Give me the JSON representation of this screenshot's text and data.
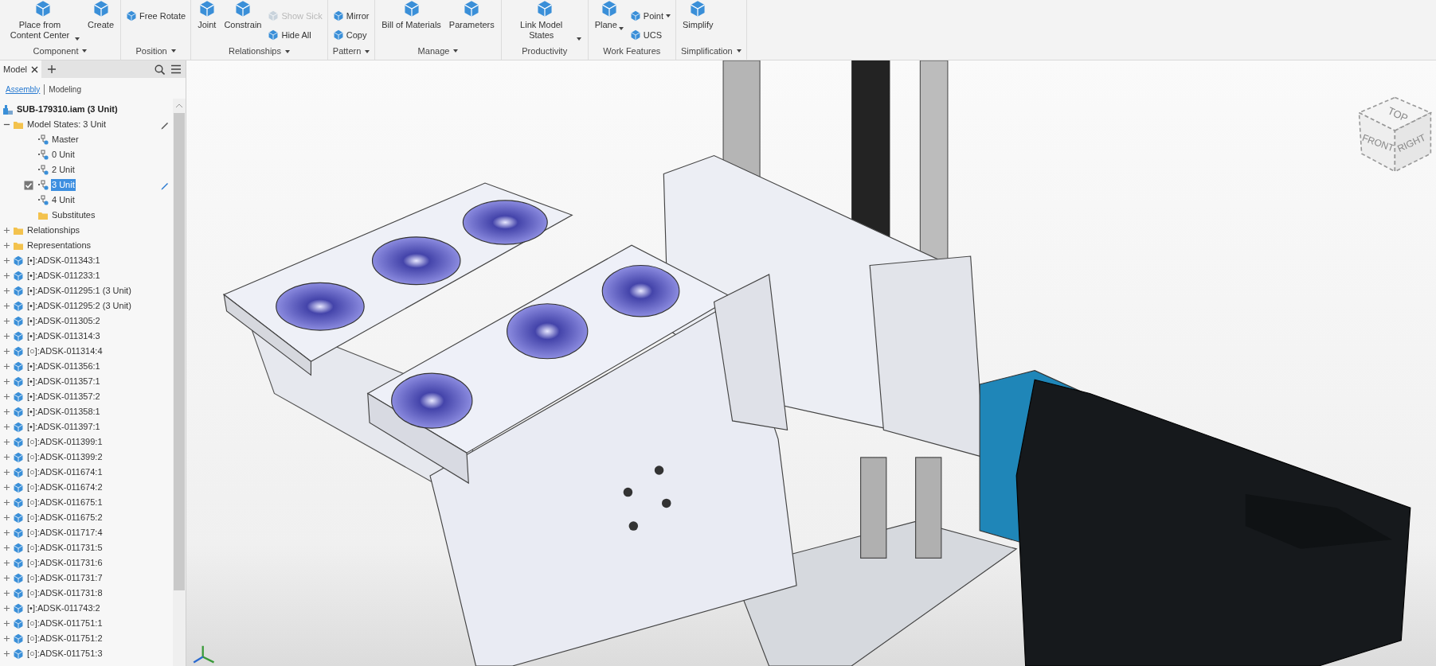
{
  "ribbon": {
    "groups": [
      {
        "label": "Component",
        "menu": true,
        "items": [
          {
            "kind": "large",
            "label": "Place from Content Center",
            "dropdown": true
          },
          {
            "kind": "large",
            "label": "Create",
            "dropdown": false
          }
        ]
      },
      {
        "label": "Position",
        "menu": true,
        "items": [
          {
            "kind": "stack",
            "buttons": [
              {
                "label": "Free Rotate",
                "disabled": false,
                "dropdown": false
              }
            ]
          }
        ]
      },
      {
        "label": "Relationships",
        "menu": true,
        "items": [
          {
            "kind": "large",
            "label": "Joint",
            "dropdown": false
          },
          {
            "kind": "large",
            "label": "Constrain",
            "dropdown": false
          },
          {
            "kind": "stack",
            "buttons": [
              {
                "label": "Show Sick",
                "disabled": true,
                "dropdown": false
              },
              {
                "label": "Hide All",
                "disabled": false,
                "dropdown": false
              }
            ]
          }
        ]
      },
      {
        "label": "Pattern",
        "menu": true,
        "items": [
          {
            "kind": "stack",
            "buttons": [
              {
                "label": "Mirror",
                "disabled": false,
                "dropdown": false
              },
              {
                "label": "Copy",
                "disabled": false,
                "dropdown": false
              }
            ]
          }
        ]
      },
      {
        "label": "Manage",
        "menu": true,
        "items": [
          {
            "kind": "large",
            "label": "Bill of Materials",
            "dropdown": false
          },
          {
            "kind": "large",
            "label": "Parameters",
            "dropdown": false
          }
        ]
      },
      {
        "label": "Productivity",
        "menu": false,
        "items": [
          {
            "kind": "large",
            "label": "Link Model States",
            "dropdown": true
          }
        ]
      },
      {
        "label": "Work Features",
        "menu": false,
        "items": [
          {
            "kind": "large",
            "label": "Plane",
            "dropdown": true
          },
          {
            "kind": "stack",
            "buttons": [
              {
                "label": "Point",
                "disabled": false,
                "dropdown": true
              },
              {
                "label": "UCS",
                "disabled": false,
                "dropdown": false
              }
            ]
          }
        ]
      },
      {
        "label": "Simplification",
        "menu": true,
        "items": [
          {
            "kind": "large",
            "label": "Simplify",
            "dropdown": false
          }
        ]
      }
    ]
  },
  "browser": {
    "tabs": [
      {
        "label": "Model",
        "selected": true
      }
    ],
    "modes": [
      {
        "label": "Assembly",
        "selected": true
      },
      {
        "label": "Modeling",
        "selected": false
      }
    ],
    "tree": {
      "label": "SUB-179310.iam (3 Unit)",
      "kind": "assembly",
      "children": [
        {
          "label": "Model States: 3 Unit",
          "kind": "folder",
          "expanded": true,
          "pencil": true,
          "children": [
            {
              "label": "Master",
              "kind": "state",
              "checked": false,
              "selected": false
            },
            {
              "label": "0 Unit",
              "kind": "state",
              "checked": false,
              "selected": false
            },
            {
              "label": "2 Unit",
              "kind": "state",
              "checked": false,
              "selected": false
            },
            {
              "label": "3 Unit",
              "kind": "state",
              "checked": true,
              "selected": true
            },
            {
              "label": "4 Unit",
              "kind": "state",
              "checked": false,
              "selected": false
            },
            {
              "label": "Substitutes",
              "kind": "folder",
              "expanded": false,
              "pencil": false
            }
          ]
        },
        {
          "label": "Relationships",
          "kind": "folder",
          "expanded": false,
          "pencil": false
        },
        {
          "label": "Representations",
          "kind": "folder",
          "expanded": false,
          "pencil": false
        },
        {
          "label": "[•]:ADSK-011343:1",
          "kind": "part",
          "expanded": false
        },
        {
          "label": "[•]:ADSK-011233:1",
          "kind": "part",
          "expanded": false
        },
        {
          "label": "[•]:ADSK-011295:1 (3 Unit)",
          "kind": "part",
          "expanded": false
        },
        {
          "label": "[•]:ADSK-011295:2 (3 Unit)",
          "kind": "part",
          "expanded": false
        },
        {
          "label": "[•]:ADSK-011305:2",
          "kind": "part",
          "expanded": false
        },
        {
          "label": "[•]:ADSK-011314:3",
          "kind": "part",
          "expanded": false
        },
        {
          "label": "[○]:ADSK-011314:4",
          "kind": "part",
          "expanded": false
        },
        {
          "label": "[•]:ADSK-011356:1",
          "kind": "part",
          "expanded": false
        },
        {
          "label": "[•]:ADSK-011357:1",
          "kind": "part",
          "expanded": false
        },
        {
          "label": "[•]:ADSK-011357:2",
          "kind": "part",
          "expanded": false
        },
        {
          "label": "[•]:ADSK-011358:1",
          "kind": "part",
          "expanded": false
        },
        {
          "label": "[•]:ADSK-011397:1",
          "kind": "part",
          "expanded": false
        },
        {
          "label": "[○]:ADSK-011399:1",
          "kind": "part",
          "expanded": false
        },
        {
          "label": "[○]:ADSK-011399:2",
          "kind": "part",
          "expanded": false
        },
        {
          "label": "[○]:ADSK-011674:1",
          "kind": "part",
          "expanded": false
        },
        {
          "label": "[○]:ADSK-011674:2",
          "kind": "part",
          "expanded": false
        },
        {
          "label": "[○]:ADSK-011675:1",
          "kind": "part",
          "expanded": false
        },
        {
          "label": "[○]:ADSK-011675:2",
          "kind": "part",
          "expanded": false
        },
        {
          "label": "[○]:ADSK-011717:4",
          "kind": "part",
          "expanded": false
        },
        {
          "label": "[○]:ADSK-011731:5",
          "kind": "part",
          "expanded": false
        },
        {
          "label": "[○]:ADSK-011731:6",
          "kind": "part",
          "expanded": false
        },
        {
          "label": "[○]:ADSK-011731:7",
          "kind": "part",
          "expanded": false
        },
        {
          "label": "[○]:ADSK-011731:8",
          "kind": "part",
          "expanded": false
        },
        {
          "label": "[•]:ADSK-011743:2",
          "kind": "part",
          "expanded": false
        },
        {
          "label": "[○]:ADSK-011751:1",
          "kind": "part",
          "expanded": false
        },
        {
          "label": "[○]:ADSK-011751:2",
          "kind": "part",
          "expanded": false
        },
        {
          "label": "[○]:ADSK-011751:3",
          "kind": "part",
          "expanded": false
        }
      ]
    }
  },
  "viewport": {
    "view_cube": {
      "faces": [
        "TOP",
        "FRONT",
        "RIGHT"
      ]
    }
  }
}
